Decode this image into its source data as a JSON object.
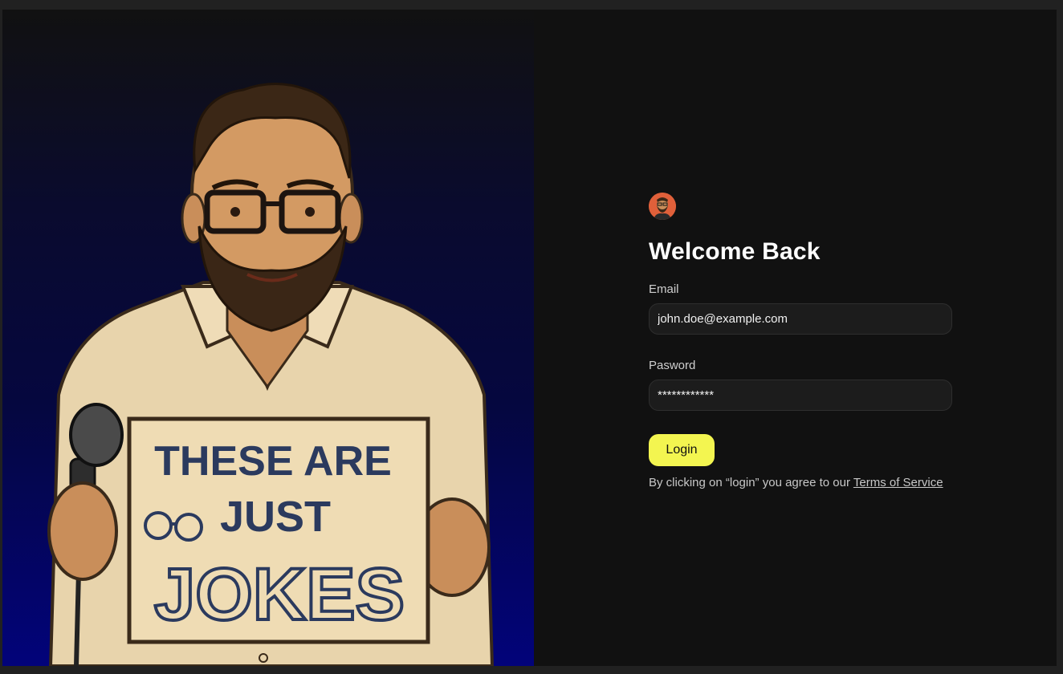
{
  "hero": {
    "sign": {
      "line1": "THESE ARE",
      "line2": "JUST",
      "line3": "JOKES"
    }
  },
  "login": {
    "avatar_icon": "user-avatar",
    "title": "Welcome Back",
    "email_label": "Email",
    "email_value": "john.doe@example.com",
    "password_label": "Pasword",
    "password_value": "************",
    "login_button": "Login",
    "terms_prefix": "By clicking on “login” you agree to our ",
    "terms_link": "Terms of Service"
  },
  "colors": {
    "background": "#111111",
    "accent_button": "#f3f550",
    "hero_gradient_bottom": "#02037a"
  }
}
